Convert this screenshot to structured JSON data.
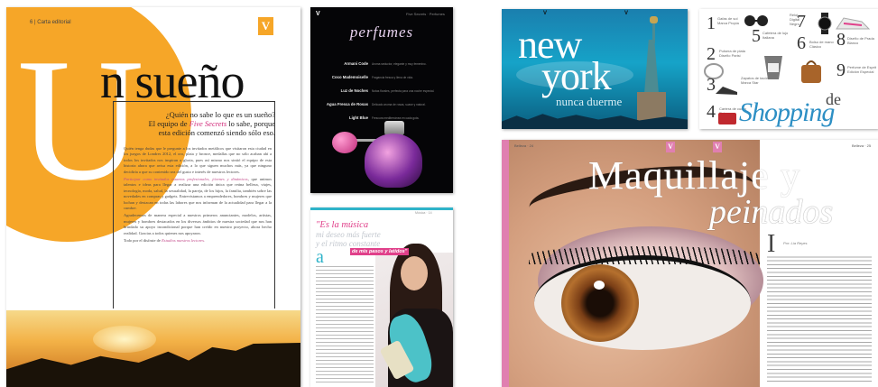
{
  "spread_sueno": {
    "title_letter": "U",
    "title_rest": "n sueño",
    "section_header": "Carta editorial",
    "page_number": "6",
    "logo_letter": "V",
    "lead_line_1": "¿Quién no sabe lo que es un sueño?",
    "lead_line_2_prefix": "El equipo de ",
    "lead_brand": "Five Secrets",
    "lead_line_2_suffix": " lo sabe, porque",
    "lead_line_3": "esta edición comenzó siendo sólo eso.",
    "body_p1": "Quién tenga dudas que le pregunte a los invitados metálicos que visitaron esta ciudad en los juegos de Londres 2012, el oro, plata y bronce, medallas que no sólo acaban ahí a todos los invitados nos inspiran a gloria, pues así mismo nos sintió el equipo de esta historia ahora que avisa esta edición, a lo que siguen muchos más, ya que ninguno decidiría a que su contenido sea del gusto e interés de nuestros lectores.",
    "body_p2_lead": "Participar como invitados estamos profesionales, jóvenes y dinámicos",
    "body_p2": ", que unimos talentos e ideas para llegar a realizar una edición única que reúna belleza, viajes, tecnología, moda, salud, la sexualidad, la pareja, de los hijos, la familia, también sobre las novedades en compras y gadgets. Entrevistamos a emprendedores, hombres y mujeres que luchan y destacan en todas las labores que nos informan de la actualidad para llegar a la cumbre.",
    "body_p3": "Agradecemos de manera especial a nuestros primeros anunciantes, modelos, artistas, mujeres y hombres destacados en los diversos ámbitos de nuestra sociedad que nos han brindado su apoyo incondicional porque han creído en nuestro proyecto, ahora hecho realidad. Gracias a todos quienes nos apoyaron.",
    "body_p4_prefix": "Todo por el disfrute de ",
    "body_p4_brand": "Estudios nuestros lectores."
  },
  "spread_perfumes": {
    "title": "perfumes",
    "logo_letter": "V",
    "header": "Five Secrets · Perfumes",
    "items": [
      {
        "name": "Armani Code",
        "desc": "Aroma seductor, elegante y muy femenino."
      },
      {
        "name": "Coco Mademoiselle",
        "desc": "Fragancia fresca y llena de vida."
      },
      {
        "name": "Luz de Noches",
        "desc": "Notas florales, perfecta para una noche especial."
      },
      {
        "name": "Agua Fresca de Rosas",
        "desc": "Delicado aroma de rosas, suave y natural."
      },
      {
        "name": "Light Blue",
        "desc": "Frescura mediterránea en cada gota."
      }
    ]
  },
  "spread_music": {
    "header": "Música · 14",
    "quote_line_1": "\"Es la música",
    "quote_line_2": "mi deseo más fuerte",
    "quote_line_3": "y el ritmo constante",
    "quote_line_4": "de mis pasos y latidos\"",
    "drop_letter": "a"
  },
  "spread_ny": {
    "logo_left": "V",
    "logo_right": "V",
    "word_1": "new",
    "word_2": "york",
    "subtitle": "nunca duerme"
  },
  "spread_shopping": {
    "title_de": "de",
    "title_word": "Shopping",
    "items": [
      {
        "num": "1",
        "label": "Gafas de sol Marca Propia"
      },
      {
        "num": "2",
        "label": "Pulsera de plata Diseño Parisi"
      },
      {
        "num": "3",
        "label": "Zapatos de tacón Marca Star"
      },
      {
        "num": "4",
        "label": "Cartera de cuero Roja"
      },
      {
        "num": "5",
        "label": "Cafetera de lujo Italiana"
      },
      {
        "num": "6",
        "label": "Bolso de mano Clásico"
      },
      {
        "num": "7",
        "label": "Reloj Digital Negro"
      },
      {
        "num": "8",
        "label": "Diseño de Prada Blanco"
      },
      {
        "num": "9",
        "label": "Perfume de Esprit Edición Especial"
      }
    ]
  },
  "spread_maquillaje": {
    "title_line_1": "Maquillaje y",
    "title_line_2": "peinados",
    "header_left": "Belleza · 24",
    "header_right": "Belleza · 25",
    "logo_a": "V",
    "logo_b": "V",
    "drop_letter": "I",
    "author": "Por: Lía Reyes"
  },
  "colors": {
    "orange": "#f6a628",
    "pink": "#e0408a",
    "teal": "#2fb3c9",
    "blue": "#2d8fc4"
  }
}
